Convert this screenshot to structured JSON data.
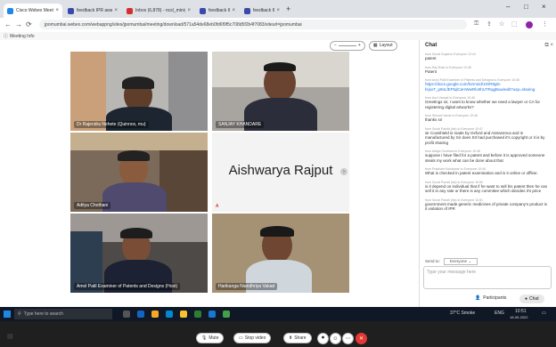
{
  "browser": {
    "tabs": [
      {
        "title": "Cisco Webex Meetings",
        "favicon_color": "#1e88e5"
      },
      {
        "title": "feedback IPR awareness session",
        "favicon_color": "#3949ab"
      },
      {
        "title": "Inbox (6,878) - ncsl_mini@tcm...",
        "favicon_color": "#d32f2f"
      },
      {
        "title": "feedback IPR awareness session",
        "favicon_color": "#3949ab"
      },
      {
        "title": "feedback IPR awareness session",
        "favicon_color": "#3949ab"
      }
    ],
    "new_tab": "+",
    "url": "jpomumbai.webex.com/webappng/sites/jpomumbai/meeting/download/571a54de68eb0fd6f9f5c708d5f2b4f7083/siteurl=jpomumbai",
    "meeting_info_label": "Meeting Info"
  },
  "meeting": {
    "layout_label": "Layout",
    "participants": [
      {
        "name": "Dr Rajendra Nehete (Quinnox, mu)"
      },
      {
        "name": "SANJAY KHANDARE"
      },
      {
        "name": "Aditya Chothani"
      },
      {
        "name": "Aishwarya Rajput",
        "initial_display": "Aishwarya Rajput",
        "initial": "A"
      },
      {
        "name": "Amol Patil Examiner of Patents and Designs (Host)"
      },
      {
        "name": "Harikanga Niandhriya Vakad"
      }
    ],
    "controls": {
      "mute": "Mute",
      "stop_video": "Stop video",
      "share": "Share",
      "participants": "Participants",
      "chat": "Chat"
    }
  },
  "chat": {
    "title": "Chat",
    "messages": [
      {
        "meta": "from Sonal Gupta to Everyone  10:44",
        "text": "patent"
      },
      {
        "meta": "from Raj Shah to Everyone  10:45",
        "text": "Patent"
      },
      {
        "meta": "from Amol Patil Examiner of Patents and Designs to Everyone  10:45",
        "text": "https://docs.google.com/forms/d/1tOR8gls-fejsxT_p9nLfEPtqlCeHWwRlo0hUTRqgBuw/edit?usp=sharing",
        "link": true
      },
      {
        "meta": "from Anvi Varade to Everyone  10:46",
        "text": "Greetings sir, I want to know whether we need a lawyer or CA for registering digital artworks?"
      },
      {
        "meta": "from Shivani Varde to Everyone  10:46",
        "text": "thanks sir"
      },
      {
        "meta": "from Sonal Pandit (ihs) to Everyone  10:47",
        "text": "sir Covishield is made by Oxford and Astrazenca and is manufactured by Sir does SII had purchased it's copyright or it is by profit sharing"
      },
      {
        "meta": "from Aditya Chothani to Everyone  10:48",
        "text": "suppose i have filed for a patent and before it is approved someone steals my work what can be done about that"
      },
      {
        "meta": "from Prashant Kondawar to Everyone  10:49",
        "text": "What is checked in patent examination and is it online or offline."
      },
      {
        "meta": "from Sonal Pandit (ihs) to Everyone  10:50",
        "text": "is it depend on individual that if he want to sell his patent then he can sell it in any rate or there is any commitee which decides it's price"
      },
      {
        "meta": "from Sonal Pandit (ihs) to Everyone  10:51",
        "text": "government made generic medicines of private company's product is it violation of IPR"
      }
    ],
    "send_to_label": "Send to:",
    "send_to_value": "Everyone",
    "input_placeholder": "Type your message here"
  },
  "taskbar": {
    "search_placeholder": "Type here to search",
    "weather": "37°C Smoke",
    "language": "ENG",
    "time": "10:51",
    "date": "18-05-2022"
  }
}
